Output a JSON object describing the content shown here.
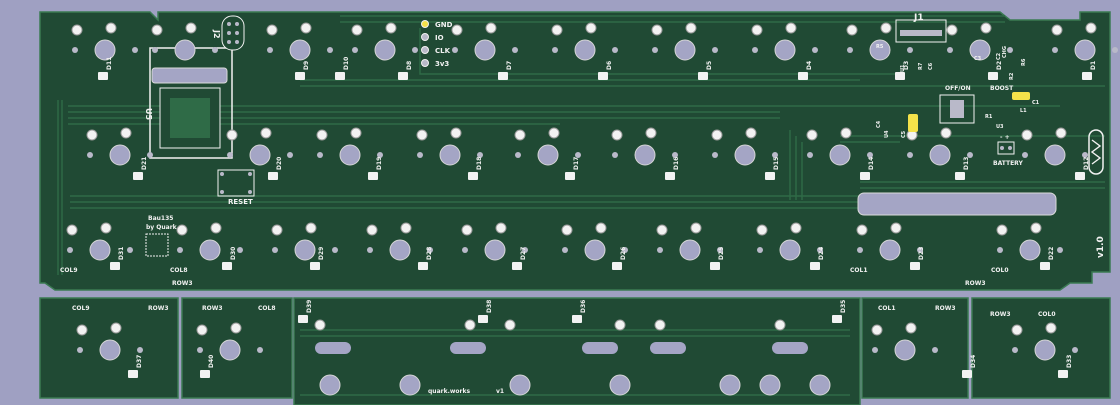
{
  "board": {
    "header_pins": [
      "GND",
      "IO",
      "CLK",
      "3v3"
    ],
    "module": "U5",
    "connectors": {
      "usb": "J1",
      "swd": "J2"
    },
    "reset_label": "RESET",
    "power_switch_label": "OFF/ON",
    "boost_label": "BOOST",
    "battery_label": "BATTERY",
    "battery_polarity": "- +",
    "chg_label": "CHG",
    "brand_line1": "Bau135",
    "brand_line2": "by Quark",
    "version": "v1.0",
    "footer_brand": "quark.works",
    "footer_version": "v1",
    "refs": {
      "U4": "U4",
      "U3": "U3",
      "U1": "U1",
      "R1": "R1",
      "R2": "R2",
      "R5": "R5",
      "R6": "R6",
      "R7": "R7",
      "C1": "C1",
      "C2": "C2",
      "C3": "C3",
      "C4": "C4",
      "C5": "C5",
      "C6": "C6",
      "C7": "C7",
      "L1": "L1"
    }
  },
  "row1_diodes": [
    "D11",
    "D9",
    "D10",
    "D8",
    "D7",
    "D6",
    "D5",
    "D4",
    "D3",
    "D2",
    "D1"
  ],
  "row2_diodes": [
    "D21",
    "D20",
    "D19",
    "D18",
    "D17",
    "D16",
    "D15",
    "D14",
    "D13",
    "D12"
  ],
  "row3_diodes": [
    "D31",
    "D30",
    "D29",
    "D28",
    "D27",
    "D26",
    "D25",
    "D24",
    "D23",
    "D22"
  ],
  "bottom_diodes": [
    "D37",
    "D40",
    "D39",
    "D38",
    "D36",
    "D35",
    "D34",
    "D33"
  ],
  "net_labels": {
    "col9": "COL9",
    "col8": "COL8",
    "col1": "COL1",
    "col0": "COL0",
    "row3": "ROW3"
  },
  "colors": {
    "background": "#9fa0c2",
    "board": "#204a34",
    "copper": "#2f6b47",
    "pad": "#b9b9c9",
    "hole": "#a4a5c5",
    "silkscreen": "#f2f2f2",
    "led_yellow": "#f4e24a"
  }
}
